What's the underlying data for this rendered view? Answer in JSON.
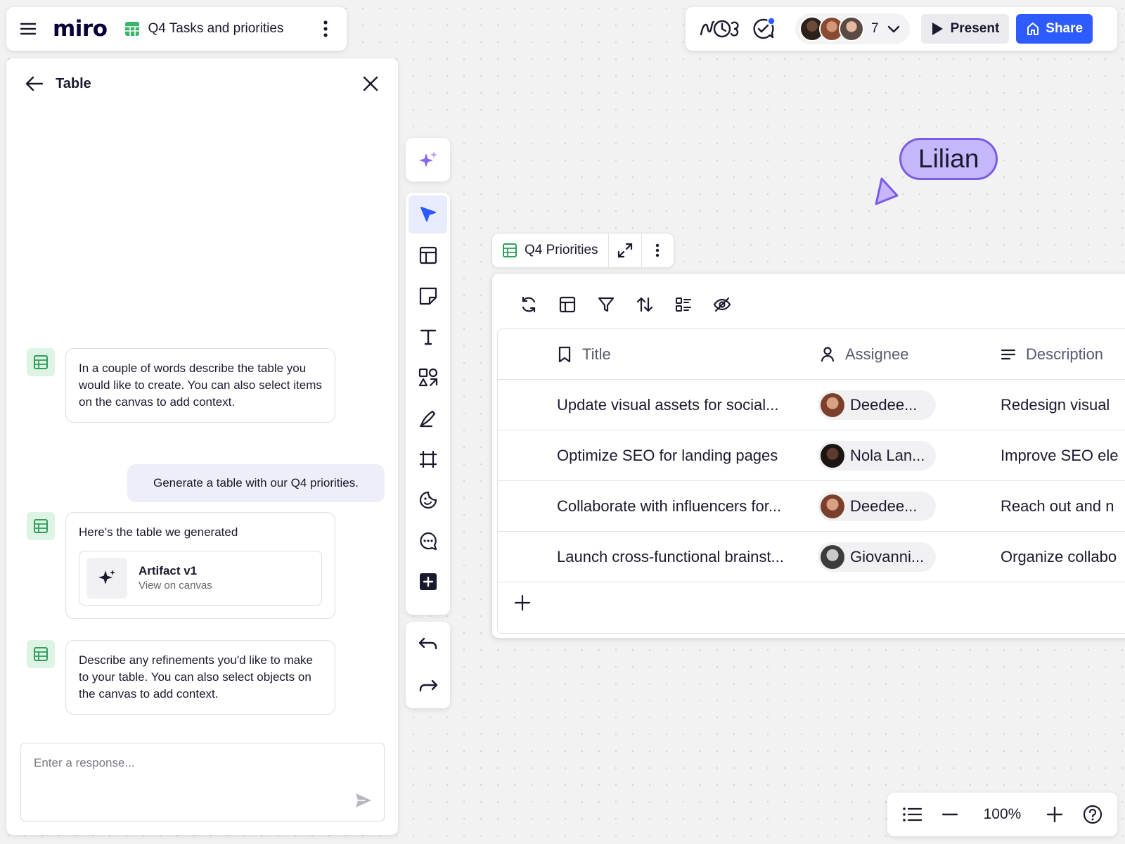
{
  "header": {
    "logo": "miro",
    "board_title": "Q4 Tasks and priorities"
  },
  "collab": {
    "avatar_count": "7",
    "present_label": "Present",
    "share_label": "Share",
    "brand_color": "#2e5bff"
  },
  "panel": {
    "title": "Table",
    "messages": [
      {
        "text": "In a couple of words describe the table you would like to create. You can also select items on the canvas to add context."
      },
      {
        "text": "Generate a table with our Q4 priorities."
      },
      {
        "text": "Here's the table we generated",
        "artifact_title": "Artifact v1",
        "artifact_sub": "View on canvas"
      },
      {
        "text": "Describe any refinements you'd like to make to your table. You can also select objects on the canvas to add context."
      }
    ],
    "response_placeholder": "Enter a response..."
  },
  "table": {
    "label": "Q4 Priorities",
    "columns": [
      "Title",
      "Assignee",
      "Description"
    ],
    "rows": [
      {
        "title": "Update visual assets for social...",
        "assignee": "Deedee...",
        "description": "Redesign visual"
      },
      {
        "title": "Optimize SEO for landing pages",
        "assignee": "Nola Lan...",
        "description": "Improve SEO ele"
      },
      {
        "title": "Collaborate with influencers for...",
        "assignee": "Deedee...",
        "description": "Reach out and n"
      },
      {
        "title": "Launch cross-functional brainst...",
        "assignee": "Giovanni...",
        "description": "Organize collabo"
      }
    ]
  },
  "cursor": {
    "name": "Lilian",
    "color": "#c6b6fb"
  },
  "zoom": {
    "level": "100%"
  },
  "icons": [
    "menu-icon",
    "table-icon",
    "kebab-icon",
    "timer-icon",
    "reactions-icon",
    "chevron-down-icon",
    "play-icon",
    "share-icon",
    "back-arrow-icon",
    "close-icon",
    "sparkle-icon",
    "send-icon",
    "select-cursor-icon",
    "templates-icon",
    "sticky-note-icon",
    "text-icon",
    "shapes-icon",
    "pen-icon",
    "frame-icon",
    "sticker-icon",
    "comment-icon",
    "add-app-icon",
    "undo-icon",
    "redo-icon",
    "refresh-icon",
    "layout-icon",
    "filter-icon",
    "sort-icon",
    "group-icon",
    "hide-icon",
    "expand-icon",
    "bookmark-icon",
    "person-icon",
    "description-lines-icon",
    "plus-icon",
    "list-icon",
    "minus-icon",
    "help-icon"
  ]
}
